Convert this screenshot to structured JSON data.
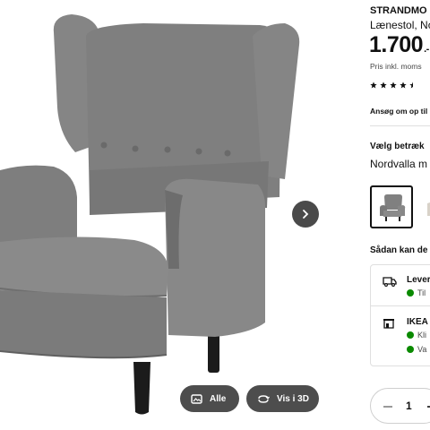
{
  "gallery": {
    "image_alt": "",
    "buttons": {
      "all_label": "Alle",
      "view3d_label": "Vis i 3D"
    }
  },
  "product": {
    "name": "STRANDMO",
    "description": "Lænestol, No",
    "price_main": "1.700",
    "price_suffix": ".-",
    "vat_note": "Pris inkl. moms",
    "rating_stars": 4.5,
    "apply_link": "Ansøg om op til"
  },
  "cover": {
    "label": "Vælg betræk",
    "value": "Nordvalla m"
  },
  "delivery": {
    "heading": "Sådan kan de",
    "option1": {
      "title": "Lever",
      "status": "Til"
    },
    "option2": {
      "title": "IKEA C",
      "lines": [
        "Kli",
        "Va"
      ]
    }
  },
  "quantity": {
    "value": "1"
  },
  "colors": {
    "chair_fabric": "#808080",
    "available": "#0a8a00",
    "dark_button": "#4d4d4d"
  }
}
